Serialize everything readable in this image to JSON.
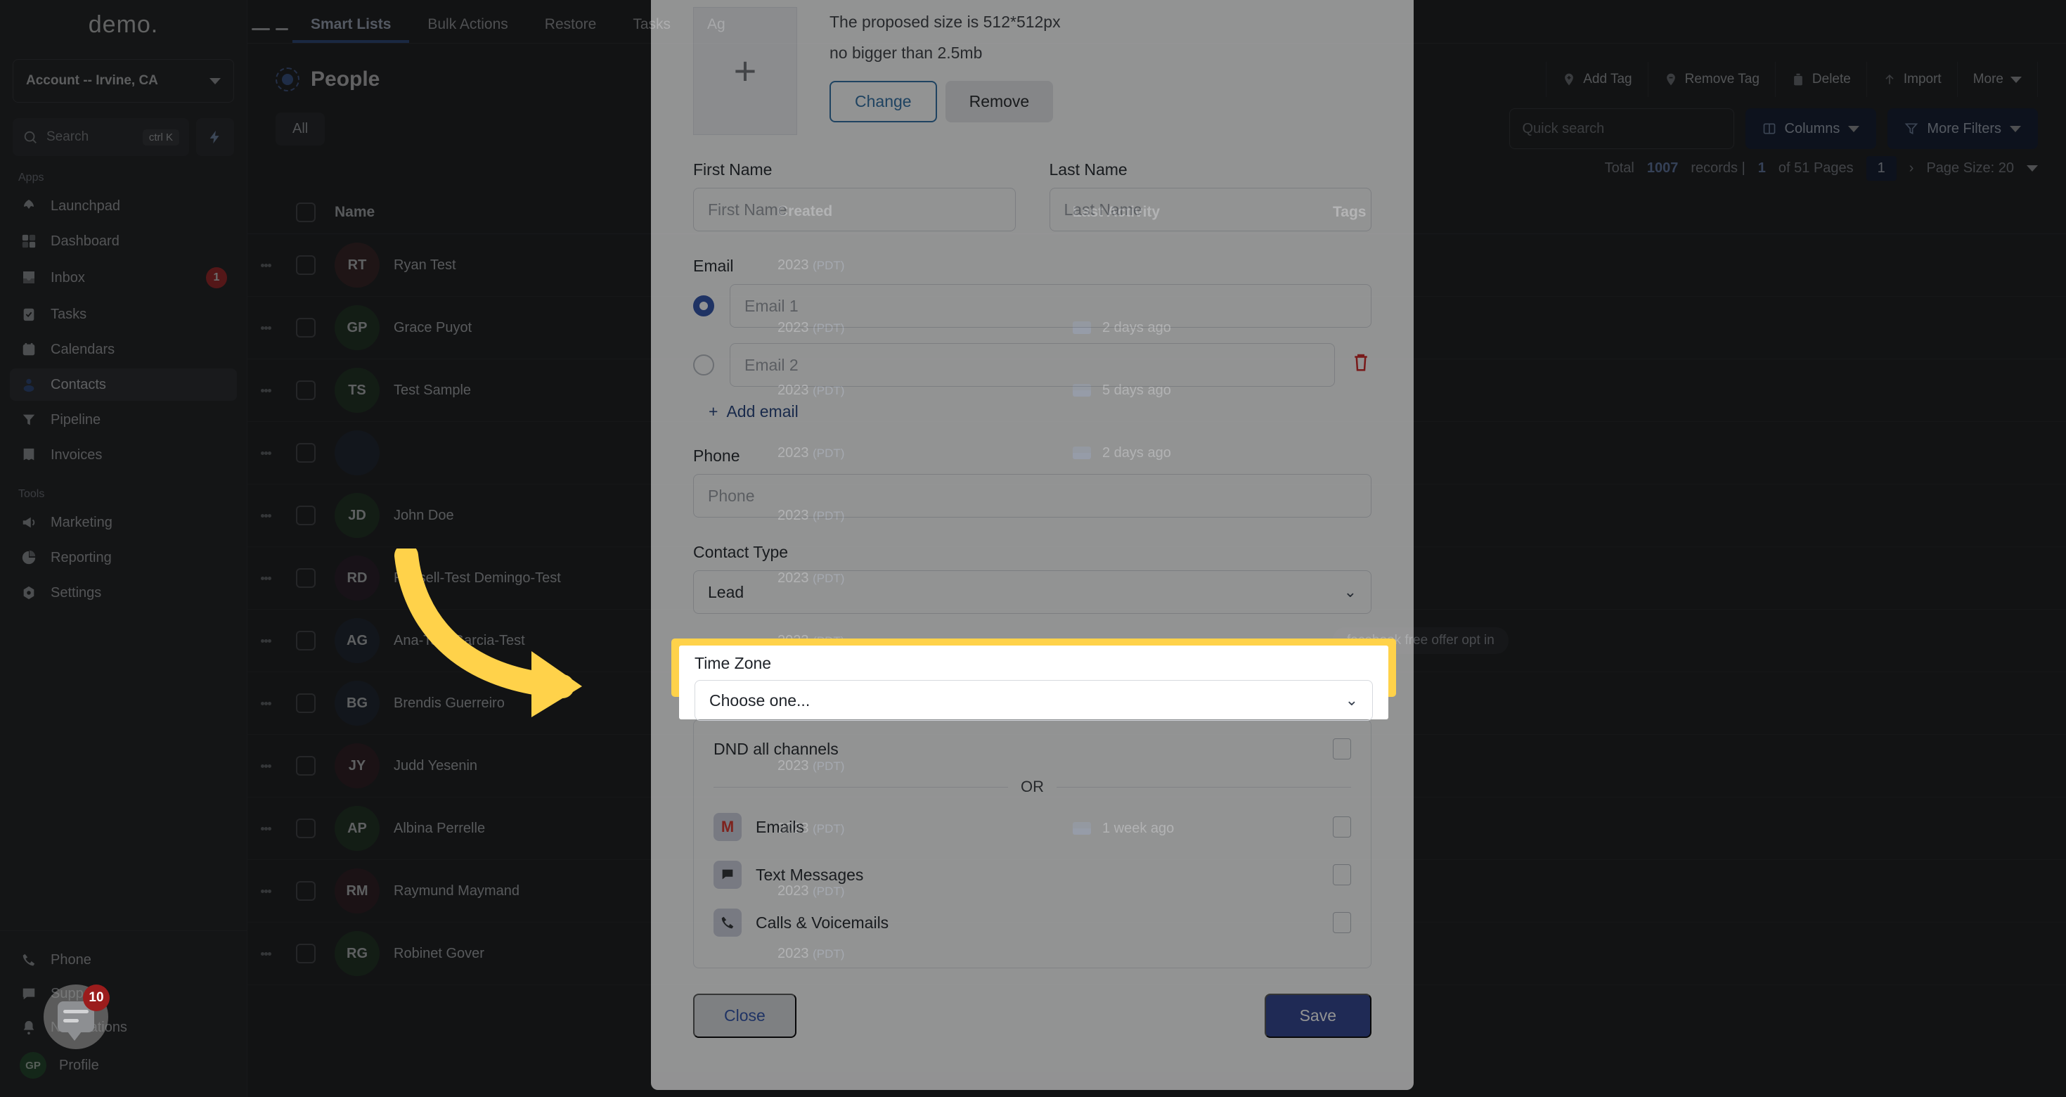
{
  "sidebar": {
    "brand": "demo.",
    "account_selector": "Account -- Irvine, CA",
    "search": {
      "label": "Search",
      "shortcut": "ctrl K"
    },
    "groups": [
      {
        "label": "Apps",
        "items": [
          {
            "label": "Launchpad",
            "icon": "rocket-icon",
            "badge": ""
          },
          {
            "label": "Dashboard",
            "icon": "grid-icon",
            "badge": ""
          },
          {
            "label": "Inbox",
            "icon": "inbox-icon",
            "badge": "1"
          },
          {
            "label": "Tasks",
            "icon": "clipboard-check-icon",
            "badge": ""
          },
          {
            "label": "Calendars",
            "icon": "calendar-icon",
            "badge": ""
          },
          {
            "label": "Contacts",
            "icon": "person-icon",
            "badge": "",
            "active": true
          },
          {
            "label": "Pipeline",
            "icon": "funnel-icon",
            "badge": ""
          },
          {
            "label": "Invoices",
            "icon": "invoice-icon",
            "badge": ""
          }
        ]
      },
      {
        "label": "Tools",
        "items": [
          {
            "label": "Marketing",
            "icon": "megaphone-icon",
            "badge": ""
          },
          {
            "label": "Reporting",
            "icon": "pie-chart-icon",
            "badge": ""
          },
          {
            "label": "Settings",
            "icon": "gear-icon",
            "badge": ""
          }
        ]
      }
    ],
    "bottom_items": [
      {
        "label": "Phone",
        "icon": "phone-icon"
      },
      {
        "label": "Support",
        "icon": "chat-icon"
      },
      {
        "label": "Notifications",
        "icon": "bell-icon"
      },
      {
        "label": "Profile",
        "icon": "avatar",
        "initials": "GP"
      }
    ]
  },
  "header": {
    "tabs": [
      {
        "label": "Smart Lists",
        "active": true
      },
      {
        "label": "Bulk Actions",
        "active": false
      },
      {
        "label": "Restore",
        "active": false
      },
      {
        "label": "Tasks",
        "active": false
      },
      {
        "label": "Ag",
        "active": false
      }
    ],
    "page_title": "People",
    "toolbar": [
      {
        "label": "Add Tag",
        "icon": "tag-plus-icon"
      },
      {
        "label": "Remove Tag",
        "icon": "tag-minus-icon"
      },
      {
        "label": "Delete",
        "icon": "trash-icon"
      },
      {
        "label": "Import",
        "icon": "upload-icon"
      },
      {
        "label": "More",
        "icon": "chevron-down-icon"
      }
    ]
  },
  "filters": {
    "chip_all": "All",
    "quick_search_placeholder": "Quick search",
    "columns_label": "Columns",
    "more_filters_label": "More Filters"
  },
  "pagination": {
    "total_prefix": "Total",
    "total_count": "1007",
    "records_label": "records |",
    "current_page": "1",
    "pages_label": "of 51 Pages",
    "page_box": "1",
    "next_arrow": "›",
    "page_size_label": "Page Size: 20"
  },
  "table": {
    "columns": [
      "Name",
      "Created",
      "Last Activity",
      "Tags"
    ],
    "rows": [
      {
        "initials": "RT",
        "name": "Ryan Test",
        "av": "#4a3234",
        "date": "2023",
        "tz": "(PDT)",
        "activity": "",
        "tag": ""
      },
      {
        "initials": "GP",
        "name": "Grace Puyot",
        "av": "#2e4533",
        "date": "2023",
        "tz": "(PDT)",
        "activity": "2 days ago",
        "tag": ""
      },
      {
        "initials": "TS",
        "name": "Test Sample",
        "av": "#2e4533",
        "date": "2023",
        "tz": "(PDT)",
        "activity": "5 days ago",
        "tag": ""
      },
      {
        "initials": "",
        "name": "",
        "av": "#2b3442",
        "date": "2023",
        "tz": "(PDT)",
        "activity": "2 days ago",
        "tag": ""
      },
      {
        "initials": "JD",
        "name": "John Doe",
        "av": "#2e4533",
        "date": "2023",
        "tz": "(PDT)",
        "activity": "",
        "tag": ""
      },
      {
        "initials": "RD",
        "name": "Russell-Test Demingo-Test",
        "av": "#3a2b3a",
        "date": "2023",
        "tz": "(PDT)",
        "activity": "",
        "tag": ""
      },
      {
        "initials": "AG",
        "name": "Ana-Test Garcia-Test",
        "av": "#2b3442",
        "date": "2023",
        "tz": "(PDT)",
        "activity": "",
        "tag": "facebook free offer opt in"
      },
      {
        "initials": "BG",
        "name": "Brendis Guerreiro",
        "av": "#2b3442",
        "date": "2023",
        "tz": "(PDT)",
        "activity": "",
        "tag": ""
      },
      {
        "initials": "JY",
        "name": "Judd Yesenin",
        "av": "#402b33",
        "date": "2023",
        "tz": "(PDT)",
        "activity": "",
        "tag": ""
      },
      {
        "initials": "AP",
        "name": "Albina Perrelle",
        "av": "#2e4533",
        "date": "2023",
        "tz": "(PDT)",
        "activity": "1 week ago",
        "tag": ""
      },
      {
        "initials": "RM",
        "name": "Raymund Maymand",
        "av": "#402b33",
        "date": "2023",
        "tz": "(PDT)",
        "activity": "",
        "tag": ""
      },
      {
        "initials": "RG",
        "name": "Robinet Gover",
        "av": "#2e4533",
        "date": "2023",
        "tz": "(PDT)",
        "activity": "",
        "tag": ""
      }
    ]
  },
  "modal": {
    "avatar": {
      "placeholder_icon": "plus-icon",
      "help_line1": "The proposed size is 512*512px",
      "help_line2": "no bigger than 2.5mb",
      "change_label": "Change",
      "remove_label": "Remove"
    },
    "first_name": {
      "label": "First Name",
      "placeholder": "First Name",
      "value": ""
    },
    "last_name": {
      "label": "Last Name",
      "placeholder": "Last Name",
      "value": ""
    },
    "email": {
      "label": "Email",
      "rows": [
        {
          "placeholder": "Email 1",
          "value": "",
          "primary": true,
          "deletable": false
        },
        {
          "placeholder": "Email 2",
          "value": "",
          "primary": false,
          "deletable": true
        }
      ],
      "add_label": "Add email"
    },
    "phone": {
      "label": "Phone",
      "placeholder": "Phone",
      "value": ""
    },
    "contact_type": {
      "label": "Contact Type",
      "value": "Lead"
    },
    "time_zone": {
      "label": "Time Zone",
      "value": "Choose one..."
    },
    "dnd": {
      "all_label": "DND all channels",
      "or_label": "OR",
      "channels": [
        {
          "label": "Emails",
          "icon": "gmail-icon"
        },
        {
          "label": "Text Messages",
          "icon": "sms-icon"
        },
        {
          "label": "Calls & Voicemails",
          "icon": "call-icon"
        }
      ]
    },
    "close_label": "Close",
    "save_label": "Save"
  },
  "annotation": {
    "arrow_color": "#ffd24a",
    "highlight_color": "#ffd24a",
    "target": "Time Zone"
  },
  "chat_widget": {
    "badge": "10",
    "icon": "chat-bubble-icon"
  }
}
